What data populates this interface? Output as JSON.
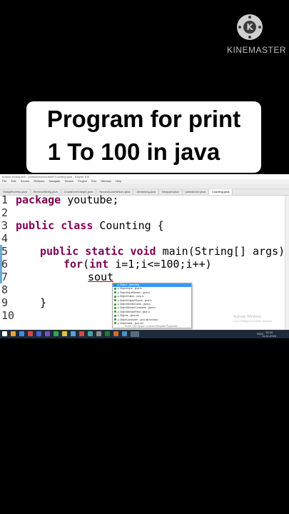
{
  "watermark": {
    "brand": "KINEMASTER",
    "logo_letter": "K"
  },
  "title_card": {
    "line1": "Program for print",
    "line2": "1 To 100 in java"
  },
  "window": {
    "title": "eclipse-workspace - youtube/src/youtube/Counting.java - Eclipse IDE",
    "menu": [
      "File",
      "Edit",
      "Source",
      "Refactor",
      "Navigate",
      "Search",
      "Project",
      "Run",
      "Window",
      "Help"
    ],
    "tabs": [
      "StringReverse.java",
      "ReverseString.java",
      "CountEvenInteger.java",
      "SecondLowestNum.java",
      "Armstrong.java",
      "Wrapper.java",
      "palindrome.java",
      "Counting.java"
    ]
  },
  "code": {
    "line_numbers": [
      "1",
      "2",
      "3",
      "4",
      "5",
      "6",
      "7",
      "8",
      "9",
      "10"
    ],
    "line1_kw": "package",
    "line1_rest": " youtube;",
    "line3_kw1": "public",
    "line3_kw2": "class",
    "line3_rest": " Counting {",
    "line5_kw1": "public",
    "line5_kw2": "static",
    "line5_kw3": "void",
    "line5_rest": " main(String[] args) {",
    "line6_kw1": "for",
    "line6_p": "(",
    "line6_kw2": "int",
    "line6_rest": " i=1;i<=100;i++)",
    "line7_text": "sout",
    "line9_text": "}"
  },
  "autocomplete": {
    "items": [
      "▸ Object - java.lang",
      "▸ ObjectInput - java.io",
      "▸ ObjectInputStream - java.io",
      "▸ ObjectOutput - java.io",
      "▸ ObjectOutputStream - java.io",
      "▸ ObjectStreamClass - java.io",
      "▸ ObjectStreamConstants - java.io",
      "▸ ObjectStreamField - java.io",
      "▸ Objects - java.util",
      "▸ ObjIntConsumer - java.util.function",
      "▸ Observable - java.util"
    ],
    "footer": "Press 'Ctrl+Space' to show Template Proposals"
  },
  "system": {
    "activate_line1": "Activate Windows",
    "activate_line2": "Go to Settings to activate Windows.",
    "lang": "ENG",
    "time": "15:33",
    "date": "11-11-2024"
  }
}
